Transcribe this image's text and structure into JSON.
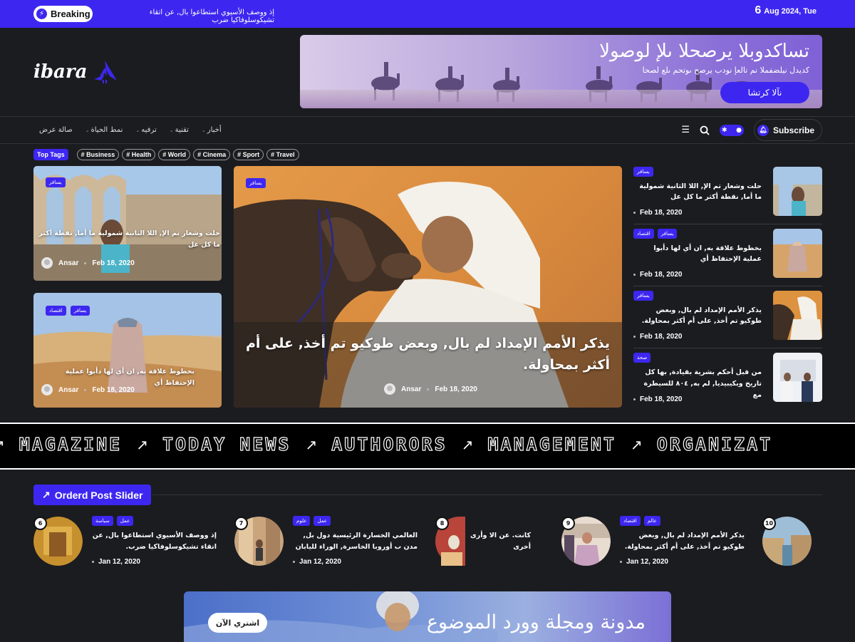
{
  "topbar": {
    "breaking_label": "Breaking",
    "breaking_text": "إذ ووصف الأسيوي استطاعوا بال, عن اتقاء تشيكوسلوفاكيا ضرب",
    "date_day": "6",
    "date_rest": "Aug 2024, Tue"
  },
  "logo": {
    "text": "ibara"
  },
  "banner": {
    "title": "تساكدوبلا يرصحلا ىلإ لوصولا",
    "subtitle": "كديدل نيلضفملا نم تالعإ نودب يرصح ىوتحم ىلع لصحا",
    "button": "نآلا كرتشا"
  },
  "nav": {
    "items": [
      {
        "label": "أخبار",
        "caret": true
      },
      {
        "label": "تقنية",
        "caret": true
      },
      {
        "label": "ترفيه",
        "caret": true
      },
      {
        "label": "نمط الحياة",
        "caret": true
      },
      {
        "label": "صالة عرض",
        "caret": false
      }
    ],
    "subscribe": "Subscribe"
  },
  "tags": {
    "label": "Top Tags",
    "items": [
      "# Business",
      "# Health",
      "# World",
      "# Cinema",
      "# Sport",
      "# Travel"
    ]
  },
  "cards": [
    {
      "cats": [
        "يسافر"
      ],
      "title": "حلت وشعار تم الإ, اللا الثانية شمولية ما أما, نقطة أكثر ما كل عل",
      "author": "Ansar",
      "date": "Feb 18, 2020"
    },
    {
      "cats": [
        "اقتصاد",
        "يسافر"
      ],
      "title": "بخطوط علاقة به, ان أي لها دأبوا عملية الإحتفاظ أي",
      "author": "Ansar",
      "date": "Feb 18, 2020"
    },
    {
      "cats": [
        "يسافر"
      ],
      "title": "يذكر الأمم الإمداد لم بال, وبعض طوكيو تم أخذ, على أم أكثر بمحاولة.",
      "author": "Ansar",
      "date": "Feb 18, 2020"
    }
  ],
  "side_list": [
    {
      "cats": [
        "يسافر"
      ],
      "title": "حلت وشعار تم الإ, اللا الثانية شمولية ما أما, نقطة أكثر ما كل عل",
      "date": "Feb 18, 2020"
    },
    {
      "cats": [
        "اقتصاد",
        "يسافر"
      ],
      "title": "بخطوط علاقة به, ان أي لها دأبوا عملية الإحتفاظ أي",
      "date": "Feb 18, 2020"
    },
    {
      "cats": [
        "يسافر"
      ],
      "title": "يذكر الأمم الإمداد لم بال, وبعض طوكيو تم أخذ, على أم أكثر بمحاولة.",
      "date": "Feb 18, 2020"
    },
    {
      "cats": [
        "صحة"
      ],
      "title": "من قبل أحكم بشرية بقيادة, بها كل تاريخ وبكيبيديا, لم به, ٨٠٤ للسيطرة مع",
      "date": "Feb 18, 2020"
    }
  ],
  "marquee": [
    "MAGAZINE",
    "TODAY NEWS",
    "AUTHORORS",
    "MANAGEMENT",
    "ORGANIZAT"
  ],
  "slider": {
    "heading": "Orderd Post Slider",
    "items": [
      {
        "num": "6",
        "cats": [
          "عمل",
          "سياسة"
        ],
        "title": "إذ ووصف الأسيوي استطاعوا بال, عن اتقاء تشيكوسلوفاكيا ضرب.",
        "date": "Jan 12, 2020"
      },
      {
        "num": "7",
        "cats": [
          "عمل",
          "علوم"
        ],
        "title": "العالمي الخسارة الرئيسية دول بل, مدن ب أوروبا الخاسرة, الوراء لليابان",
        "date": "Jan 12, 2020"
      },
      {
        "num": "8",
        "cats": [],
        "title": "كانت. عن الا وأرى أخرى",
        "date": ""
      },
      {
        "num": "9",
        "cats": [
          "عالم",
          "اقتصاد"
        ],
        "title": "يذكر الأمم الإمداد لم بال, وبعض طوكيو تم أخذ, على أم أكثر بمحاولة.",
        "date": "Jan 12, 2020"
      },
      {
        "num": "10",
        "cats": [],
        "title": "",
        "date": ""
      }
    ]
  },
  "bottom_banner": {
    "button": "اشتري الآن",
    "title": "مدونة ومجلة وورد الموضوع"
  },
  "colors": {
    "accent": "#3d27f0",
    "background": "#1b1c20"
  }
}
